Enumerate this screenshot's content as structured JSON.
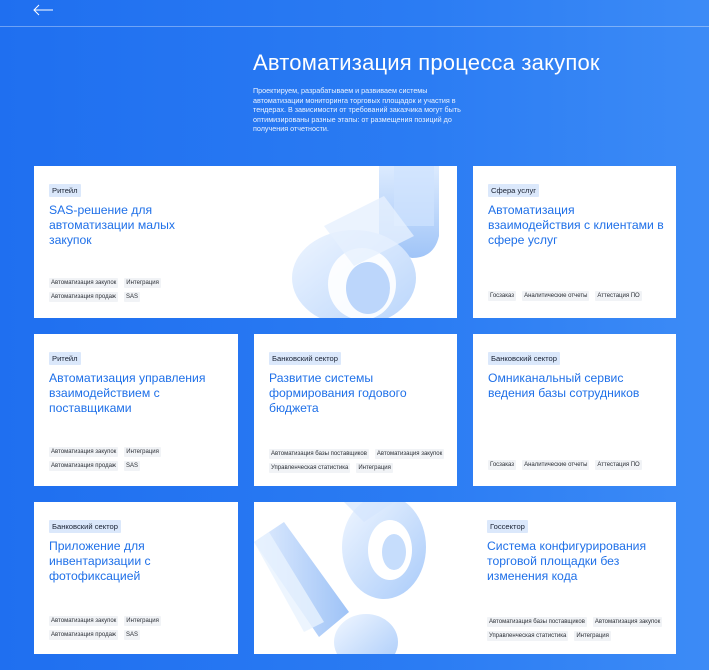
{
  "header": {
    "title": "Автоматизация процесса закупок",
    "description": "Проектируем, разрабатываем и развиваем системы автоматизации мониторинга торговых площадок и участия в тендерах. В зависимости от требований заказчика могут быть оптимизированы разные этапы: от размещения позиций до получения отчетности."
  },
  "cards": [
    {
      "badge": "Ритейл",
      "title": "SAS-решение для автоматизации малых закупок",
      "tags": [
        [
          "Автоматизация закупок",
          "Интеграция"
        ],
        [
          "Автоматизация продаж",
          "SAS"
        ]
      ]
    },
    {
      "badge": "Сфера услуг",
      "title": "Автоматизация взаимодействия с клиентами в сфере услуг",
      "tags": [
        [
          "Госзаказ",
          "Аналитические отчеты",
          "Аттестация ПО"
        ]
      ]
    },
    {
      "badge": "Ритейл",
      "title": "Автоматизация управления взаимодействием с поставщиками",
      "tags": [
        [
          "Автоматизация закупок",
          "Интеграция"
        ],
        [
          "Автоматизация продаж",
          "SAS"
        ]
      ]
    },
    {
      "badge": "Банковский сектор",
      "title": "Развитие системы формирования годового бюджета",
      "tags": [
        [
          "Автоматизация базы поставщиков",
          "Автоматизация закупок"
        ],
        [
          "Управленческая статистика",
          "Интеграция"
        ]
      ]
    },
    {
      "badge": "Банковский сектор",
      "title": "Омниканальный сервис ведения базы сотрудников",
      "tags": [
        [
          "Госзаказ",
          "Аналитические отчеты",
          "Аттестация ПО"
        ]
      ]
    },
    {
      "badge": "Банковский сектор",
      "title": "Приложение для инвентаризации с фотофиксацией",
      "tags": [
        [
          "Автоматизация закупок",
          "Интеграция"
        ],
        [
          "Автоматизация продаж",
          "SAS"
        ]
      ]
    },
    {
      "badge": "Госсектор",
      "title": "Система конфигурирования торговой площадки без изменения кода",
      "tags": [
        [
          "Автоматизация базы поставщиков",
          "Автоматизация закупок"
        ],
        [
          "Управленческая статистика",
          "Интеграция"
        ]
      ]
    }
  ],
  "colors": {
    "background": "#2176f1",
    "accent": "#1f70e8",
    "badge": "#dbe8fb"
  },
  "icons": {
    "back": "arrow-left-icon"
  }
}
